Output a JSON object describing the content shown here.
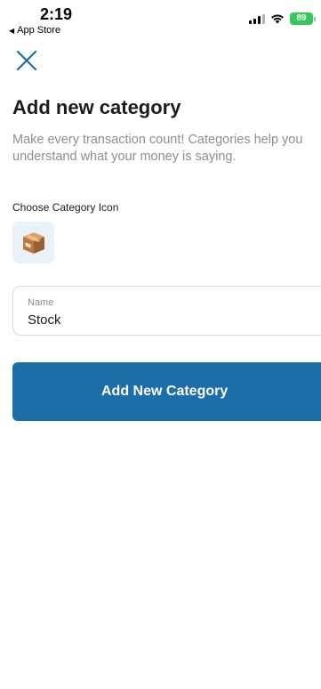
{
  "status_bar": {
    "time": "2:19",
    "back_app": "App Store",
    "battery": "89"
  },
  "header": {
    "title": "Add new category",
    "subtitle": "Make every transaction count! Categories help you understand what your money is saying."
  },
  "icon_section": {
    "label": "Choose Category Icon",
    "selected_icon": "package-box-icon"
  },
  "name_field": {
    "label": "Name",
    "value": "Stock"
  },
  "submit": {
    "label": "Add New Category"
  },
  "colors": {
    "accent": "#1c6ea8",
    "icon_tile_bg": "#eaf1f8",
    "battery": "#34c759"
  }
}
